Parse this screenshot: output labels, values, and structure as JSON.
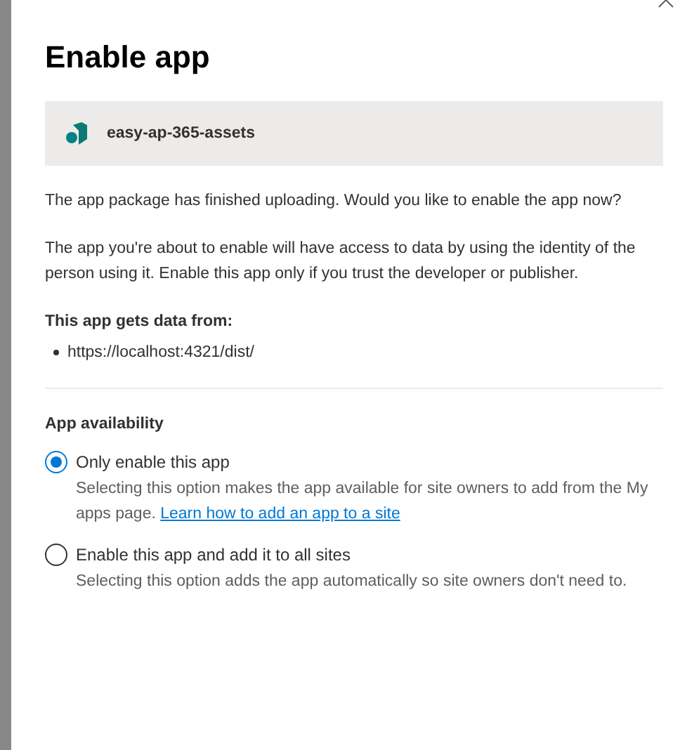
{
  "dialog": {
    "title": "Enable app",
    "package_name": "easy-ap-365-assets",
    "message": "The app package has finished uploading. Would you like to enable the app now?",
    "warning": "The app you're about to enable will have access to data by using the identity of the person using it. Enable this app only if you trust the developer or publisher.",
    "data_sources_heading": "This app gets data from:",
    "data_sources": [
      "https://localhost:4321/dist/"
    ],
    "availability_heading": "App availability",
    "options": [
      {
        "label": "Only enable this app",
        "selected": true,
        "description": "Selecting this option makes the app available for site owners to add from the My apps page.",
        "link": "Learn how to add an app to a site"
      },
      {
        "label": "Enable this app and add it to all sites",
        "selected": false,
        "description": "Selecting this option adds the app automatically so site owners don't need to."
      }
    ]
  }
}
